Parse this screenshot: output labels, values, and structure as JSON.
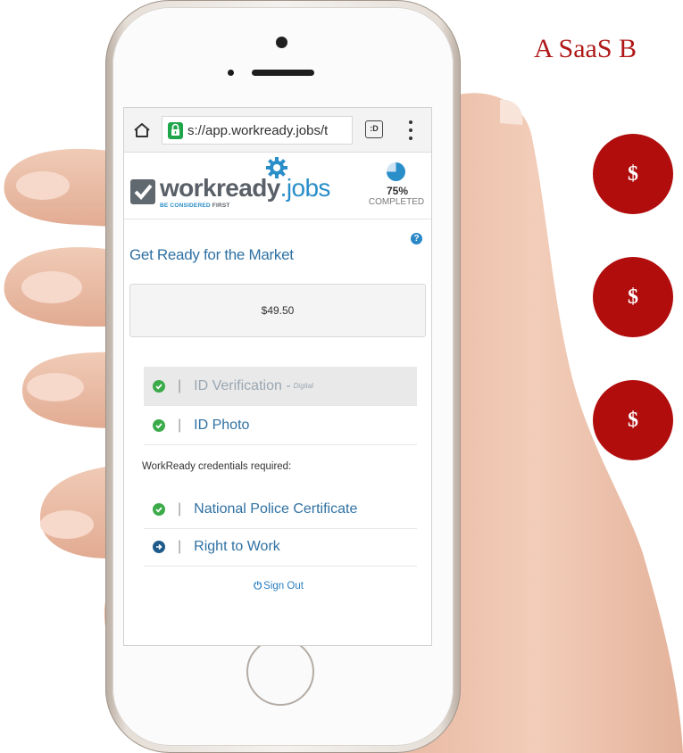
{
  "slide": {
    "title": "A SaaS B",
    "badges": [
      "$",
      "$",
      "$"
    ]
  },
  "browser": {
    "url": "s://app.workready.jobs/t",
    "tabs_icon": ":D",
    "icons": [
      "home-icon",
      "lock-icon",
      "tabs-icon",
      "menu-icon"
    ]
  },
  "header": {
    "logo_word": "workready",
    "logo_tld": ".jobs",
    "tagline_a": "BE CONSIDERED",
    "tagline_b": "FIRST",
    "progress_value": 0.75,
    "progress_percent": "75%",
    "progress_label": "COMPLETED"
  },
  "main": {
    "title": "Get Ready for the Market",
    "help_glyph": "?",
    "price": "$49.50",
    "separator": "|",
    "steps": [
      {
        "label": "ID Verification -",
        "note": "Digital",
        "status": "done"
      },
      {
        "label": "ID Photo",
        "status": "done"
      }
    ],
    "credentials_label": "WorkReady credentials required:",
    "credentials": [
      {
        "label": "National Police Certificate",
        "status": "done"
      },
      {
        "label": "Right to Work",
        "status": "next"
      }
    ],
    "sign_out_icon": "⏻",
    "sign_out": "Sign Out"
  },
  "colors": {
    "brand_blue": "#2a8ec9",
    "heading_blue": "#2f71a3",
    "done_green": "#3bab4a",
    "next_navy": "#1f5b8a",
    "badge_red": "#b10d0d",
    "lock_green": "#1fa64a"
  }
}
